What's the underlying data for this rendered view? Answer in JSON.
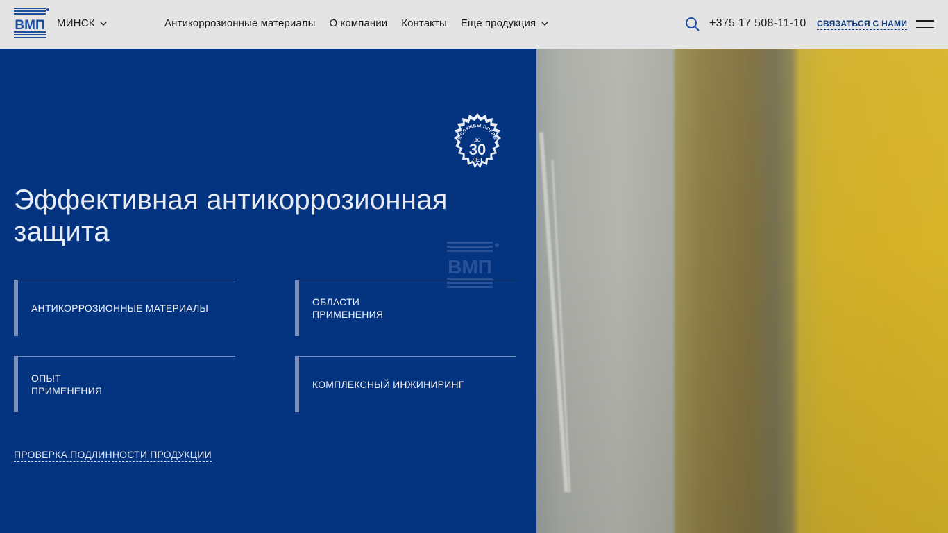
{
  "header": {
    "logo_text": "ВМП",
    "city": "МИНСК",
    "nav": [
      {
        "label": "Антикоррозионные материалы"
      },
      {
        "label": "О компании"
      },
      {
        "label": "Контакты"
      },
      {
        "label": "Еще продукция"
      }
    ],
    "phone": "+375 17 508-11-10",
    "contact_label": "СВЯЗАТЬСЯ С НАМИ"
  },
  "hero": {
    "title": "Эффективная антикоррозионная защита",
    "badge": {
      "top_text": "СРОК СЛУЖБЫ ПОКРЫТИЙ",
      "prefix": "ДО",
      "number": "30",
      "unit": "ЛЕТ"
    },
    "cards": [
      {
        "label": "АНТИКОРРОЗИОННЫЕ МАТЕРИАЛЫ"
      },
      {
        "label": "ОБЛАСТИ\nПРИМЕНЕНИЯ"
      },
      {
        "label": "ОПЫТ\nПРИМЕНЕНИЯ"
      },
      {
        "label": "КОМПЛЕКСНЫЙ ИНЖИНИРИНГ"
      }
    ],
    "authenticity_link": "ПРОВЕРКА ПОДЛИННОСТИ ПРОДУКЦИИ"
  },
  "colors": {
    "brand_blue": "#04337f",
    "header_bg": "#e4e4e4",
    "accent_yellow": "#d6b128"
  },
  "icons": [
    "vmp-logo-icon",
    "chevron-down-icon",
    "search-icon",
    "burger-menu-icon",
    "service-life-badge-icon"
  ]
}
